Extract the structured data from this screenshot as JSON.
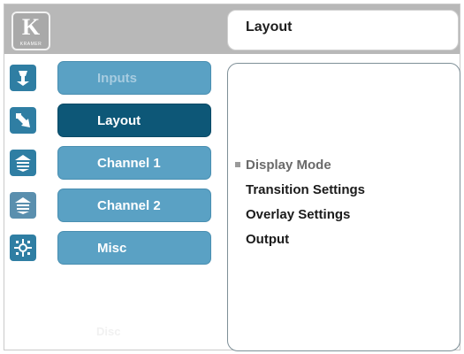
{
  "header": {
    "logo": {
      "mark": "K",
      "brand": "KRAMER",
      "icon": "kramer-logo"
    },
    "title": "Layout"
  },
  "sidebar": {
    "items": [
      {
        "label": "Inputs",
        "icon": "inputs-icon",
        "state": "dimmed"
      },
      {
        "label": "Layout",
        "icon": "layout-icon",
        "state": "active"
      },
      {
        "label": "Channel 1",
        "icon": "channel-1-icon",
        "state": "normal"
      },
      {
        "label": "Channel 2",
        "icon": "channel-2-icon",
        "state": "normal"
      },
      {
        "label": "Misc",
        "icon": "misc-icon",
        "state": "normal"
      }
    ],
    "faint_label": "Disc"
  },
  "submenu": {
    "items": [
      {
        "label": "Display Mode",
        "selected": true
      },
      {
        "label": "Transition Settings",
        "selected": false
      },
      {
        "label": "Overlay Settings",
        "selected": false
      },
      {
        "label": "Output",
        "selected": false
      }
    ]
  },
  "colors": {
    "header_bg": "#b8b8b8",
    "button": "#5aa1c4",
    "button_active": "#0d5777",
    "icon_bg": "#2f7ea3"
  }
}
